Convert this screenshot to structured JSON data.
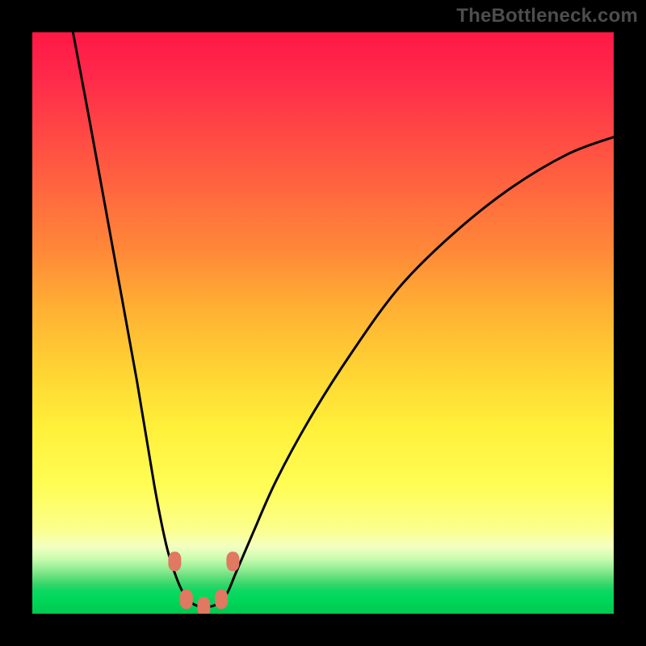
{
  "watermark": "TheBottleneck.com",
  "chart_data": {
    "type": "line",
    "title": "",
    "xlabel": "",
    "ylabel": "",
    "xlim": [
      0,
      100
    ],
    "ylim": [
      0,
      100
    ],
    "curve": [
      {
        "x": 7,
        "y": 100
      },
      {
        "x": 10,
        "y": 84
      },
      {
        "x": 14,
        "y": 62
      },
      {
        "x": 18,
        "y": 40
      },
      {
        "x": 21,
        "y": 22
      },
      {
        "x": 23,
        "y": 12
      },
      {
        "x": 24.5,
        "y": 7
      },
      {
        "x": 26,
        "y": 3.5
      },
      {
        "x": 27.5,
        "y": 1.8
      },
      {
        "x": 29,
        "y": 1.2
      },
      {
        "x": 30.5,
        "y": 1.2
      },
      {
        "x": 32,
        "y": 1.8
      },
      {
        "x": 33.5,
        "y": 3.5
      },
      {
        "x": 35,
        "y": 7
      },
      {
        "x": 38,
        "y": 14
      },
      {
        "x": 42,
        "y": 23
      },
      {
        "x": 48,
        "y": 34
      },
      {
        "x": 55,
        "y": 45
      },
      {
        "x": 63,
        "y": 56
      },
      {
        "x": 72,
        "y": 65
      },
      {
        "x": 82,
        "y": 73
      },
      {
        "x": 92,
        "y": 79
      },
      {
        "x": 100,
        "y": 82
      }
    ],
    "markers": [
      {
        "x": 24.5,
        "y": 9
      },
      {
        "x": 26.5,
        "y": 2.5
      },
      {
        "x": 29.5,
        "y": 1.2
      },
      {
        "x": 32.5,
        "y": 2.5
      },
      {
        "x": 34.5,
        "y": 9
      }
    ],
    "marker_color": "#e07862",
    "curve_color": "#000000"
  }
}
